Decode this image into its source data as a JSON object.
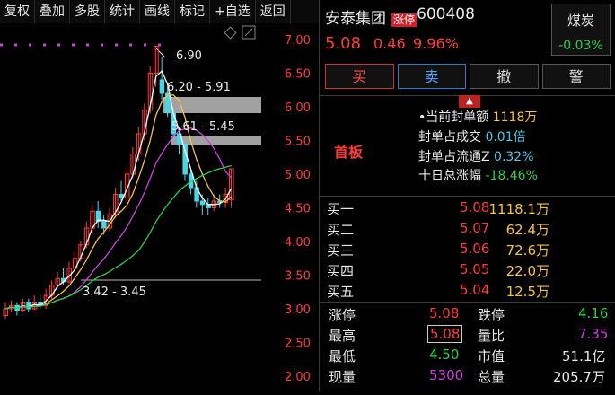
{
  "toolbar": {
    "items": [
      "复权",
      "叠加",
      "多股",
      "统计",
      "画线",
      "标记",
      "+自选",
      "返回"
    ]
  },
  "chart": {
    "y_labels": [
      "7.00",
      "6.50",
      "6.00",
      "5.50",
      "5.00",
      "4.50",
      "4.00",
      "3.50",
      "3.00",
      "2.50",
      "2.00"
    ],
    "annotation_high": "6.90",
    "zone1_label": "6.20 - 5.91",
    "zone2_label": "5.61 - 5.45",
    "zone3_label": "3.42 - 3.45"
  },
  "quote": {
    "name": "安泰集团",
    "limit_badge": "涨停",
    "code": "600408",
    "price": "5.08",
    "change": "0.46",
    "pct": "9.96%",
    "sector": "煤炭",
    "sector_pct": "-0.03%"
  },
  "trade_buttons": [
    "买",
    "卖",
    "撤",
    "警"
  ],
  "seal_info": {
    "first_board": "首板",
    "rows": [
      {
        "label": "当前封单额",
        "value": "1118万",
        "color": "y"
      },
      {
        "label": "封单占成交",
        "value": "0.01倍",
        "color": "c"
      },
      {
        "label": "封单占流通Z",
        "value": "0.32%",
        "color": "c"
      },
      {
        "label": "十日总涨幅",
        "value": "-18.46%",
        "color": "g"
      }
    ]
  },
  "order_book": [
    {
      "label": "买一",
      "price": "5.08",
      "qty": "1118.1万"
    },
    {
      "label": "买二",
      "price": "5.07",
      "qty": "62.4万"
    },
    {
      "label": "买三",
      "price": "5.06",
      "qty": "72.6万"
    },
    {
      "label": "买四",
      "price": "5.05",
      "qty": "22.0万"
    },
    {
      "label": "买五",
      "price": "5.04",
      "qty": "12.5万"
    }
  ],
  "stats": {
    "limit_up_k": "涨停",
    "limit_up_v": "5.08",
    "limit_down_k": "跌停",
    "limit_down_v": "4.16",
    "high_k": "最高",
    "high_v": "5.08",
    "vol_ratio_k": "量比",
    "vol_ratio_v": "7.35",
    "low_k": "最低",
    "low_v": "4.50",
    "mktcap_k": "市值",
    "mktcap_v": "51.1亿",
    "cur_vol_k": "现量",
    "cur_vol_v": "5300",
    "total_vol_k": "总量",
    "total_vol_v": "205.7万"
  },
  "colors": {
    "up": "#ff3b3b",
    "down": "#2fcf4a",
    "ma5": "#ffffff",
    "ma10": "#f5c242",
    "ma20": "#d040e0",
    "ma60": "#2fcf4a"
  }
}
